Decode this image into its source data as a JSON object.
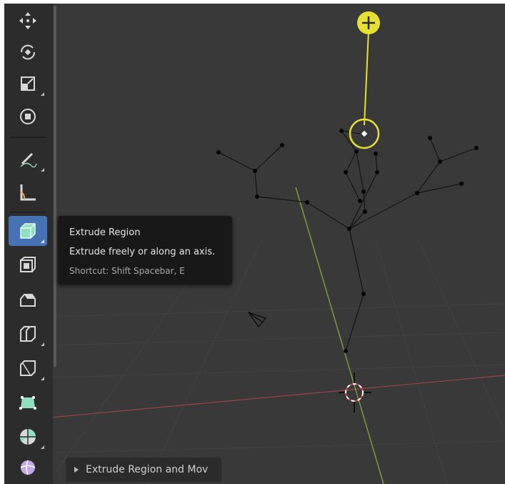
{
  "toolbar": {
    "tools": [
      {
        "name": "move",
        "icon": "move-icon"
      },
      {
        "name": "rotate",
        "icon": "rotate-icon"
      },
      {
        "name": "scale",
        "icon": "scale-icon"
      },
      {
        "name": "transform",
        "icon": "transform-icon"
      },
      {
        "name": "annotate",
        "icon": "annotate-icon"
      },
      {
        "name": "measure",
        "icon": "measure-icon"
      },
      {
        "name": "extrude-region",
        "icon": "extrude-region-icon",
        "active": true
      },
      {
        "name": "inset-faces",
        "icon": "inset-faces-icon"
      },
      {
        "name": "bevel",
        "icon": "bevel-icon"
      },
      {
        "name": "loop-cut",
        "icon": "loop-cut-icon"
      },
      {
        "name": "knife",
        "icon": "knife-icon"
      },
      {
        "name": "poly-build",
        "icon": "poly-build-icon"
      },
      {
        "name": "spin",
        "icon": "spin-icon"
      },
      {
        "name": "smooth",
        "icon": "smooth-icon"
      }
    ]
  },
  "tooltip": {
    "title": "Extrude Region",
    "description": "Extrude freely or along an axis.",
    "shortcut": "Shortcut: Shift Spacebar, E"
  },
  "operator_panel": {
    "label": "Extrude Region and Mov"
  },
  "colors": {
    "viewport_bg": "#393939",
    "toolbar_bg": "#2c2c2c",
    "active_tool": "#4772b3",
    "gizmo_yellow": "#e8e030",
    "x_axis": "#b04a4a",
    "y_axis": "#7ea33a",
    "vertex": "#000000",
    "edge": "#111111"
  }
}
